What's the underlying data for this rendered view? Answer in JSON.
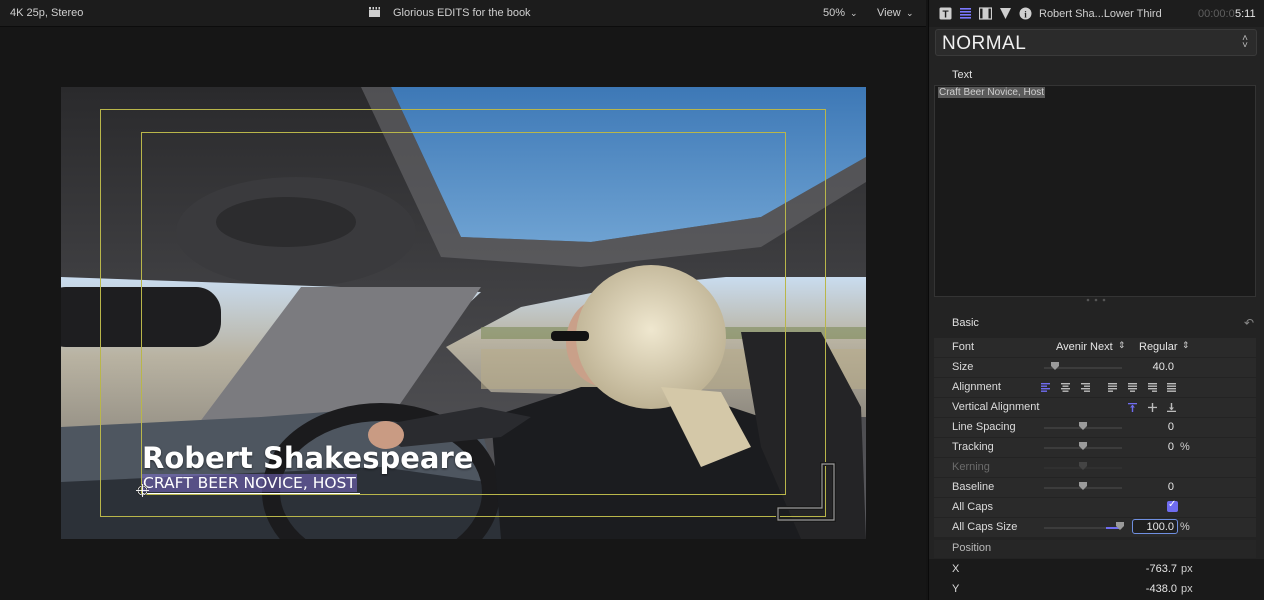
{
  "viewer": {
    "format": "4K 25p, Stereo",
    "project_title": "Glorious EDITS for the book",
    "zoom": "50%",
    "view_menu": "View"
  },
  "lower_third": {
    "name": "Robert Shakespeare",
    "title": "Craft Beer Novice, Host"
  },
  "inspector": {
    "clip_title": "Robert Sha...Lower Third",
    "timecode_dim": "00:00:0",
    "timecode": "5:11",
    "preset": "NORMAL",
    "text_section": "Text",
    "text_value": "Craft Beer Novice, Host",
    "basic_section": "Basic",
    "rows": {
      "font": {
        "label": "Font",
        "family": "Avenir Next",
        "style": "Regular"
      },
      "size": {
        "label": "Size",
        "value": "40.0"
      },
      "alignment": {
        "label": "Alignment"
      },
      "vertical_alignment": {
        "label": "Vertical Alignment"
      },
      "line_spacing": {
        "label": "Line Spacing",
        "value": "0"
      },
      "tracking": {
        "label": "Tracking",
        "value": "0",
        "unit": "%"
      },
      "kerning": {
        "label": "Kerning"
      },
      "baseline": {
        "label": "Baseline",
        "value": "0"
      },
      "all_caps": {
        "label": "All Caps",
        "checked": true
      },
      "all_caps_size": {
        "label": "All Caps Size",
        "value": "100.0",
        "unit": "%"
      }
    },
    "position": {
      "label": "Position",
      "x_label": "X",
      "x_value": "-763.7",
      "x_unit": "px",
      "y_label": "Y",
      "y_value": "-438.0",
      "y_unit": "px"
    }
  },
  "colors": {
    "accent": "#6f6cf0",
    "safe_zone": "#b9b64a"
  }
}
